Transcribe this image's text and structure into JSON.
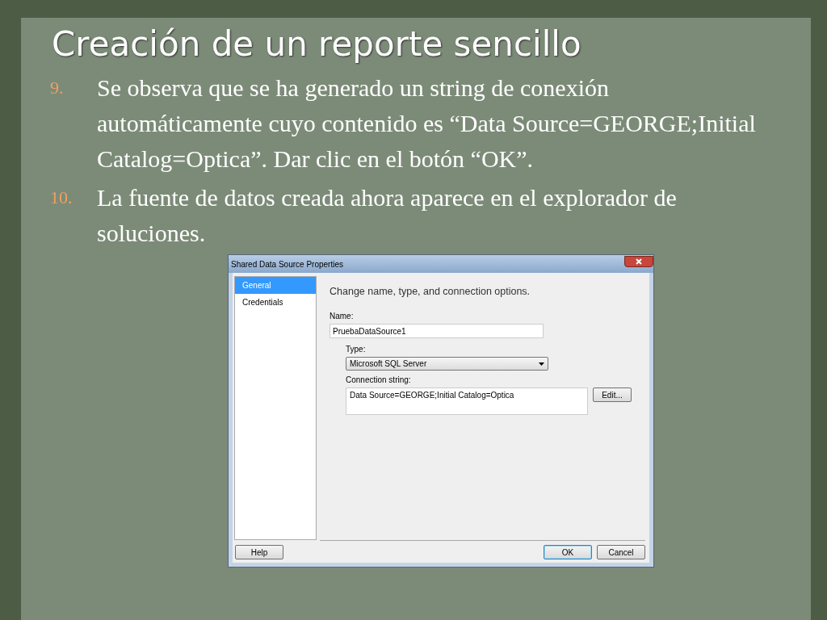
{
  "title": "Creación de un reporte sencillo",
  "steps": [
    {
      "number": "9.",
      "text": "Se observa que se ha generado un string de conexión automáticamente cuyo contenido es “Data Source=GEORGE;Initial Catalog=Optica”. Dar clic en el botón “OK”."
    },
    {
      "number": "10.",
      "text": "La fuente de datos creada ahora aparece en el explorador de soluciones."
    }
  ],
  "dialog": {
    "title": "Shared Data Source Properties",
    "nav": [
      {
        "label": "General",
        "selected": true
      },
      {
        "label": "Credentials",
        "selected": false
      }
    ],
    "heading": "Change name, type, and connection options.",
    "name_label": "Name:",
    "name_value": "PruebaDataSource1",
    "type_label": "Type:",
    "type_value": "Microsoft SQL Server",
    "connection_label": "Connection string:",
    "connection_value": "Data Source=GEORGE;Initial Catalog=Optica",
    "edit_button": "Edit...",
    "help_button": "Help",
    "footer_buttons": [
      {
        "label": "OK",
        "default": true
      },
      {
        "label": "Cancel",
        "default": false
      }
    ]
  }
}
